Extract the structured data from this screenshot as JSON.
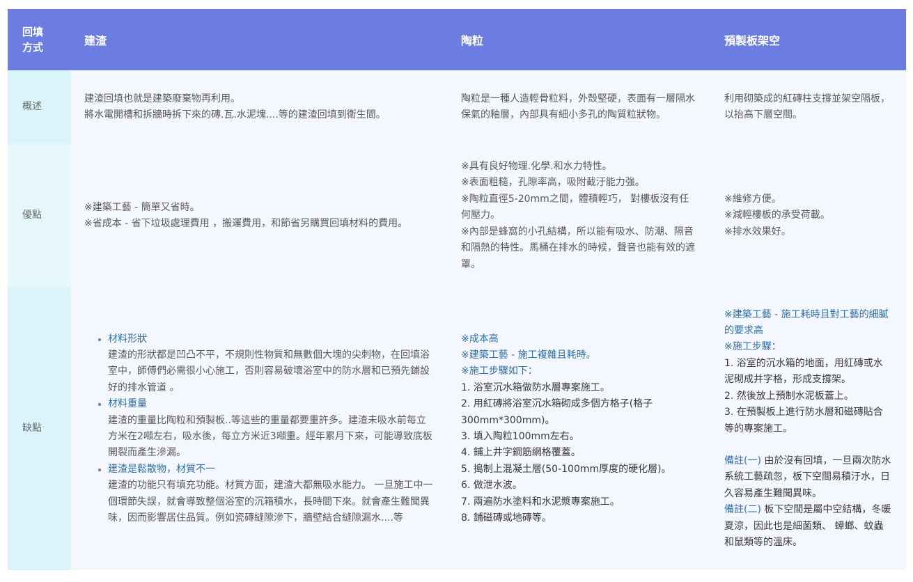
{
  "header": {
    "corner": [
      "回填",
      "方式"
    ],
    "col1": "建渣",
    "col2": "陶粒",
    "col3": "預製板架空"
  },
  "rows": {
    "overview": {
      "label": "概述",
      "col1": [
        "建渣回填也就是建築廢棄物再利用。",
        "將水電開槽和拆牆時拆下來的磚.瓦.水泥塊....等的建渣回填到衛生間。"
      ],
      "col2": [
        "陶粒是一種人造輕骨粒料，外殼堅硬，表面有一層隔水保氣的釉層，內部具有細小多孔的陶質粒狀物。"
      ],
      "col3": [
        "利用砌築成的紅磚柱支撐並架空隔板，以抬高下層空間。"
      ]
    },
    "advantages": {
      "label": "優點",
      "col1": [
        "※建築工藝 - 簡單又省時。",
        "※省成本 - 省下垃圾處理費用 ，搬運費用，和節省另購買回填材料的費用。"
      ],
      "col2": [
        "※具有良好物理.化學.和水力特性。",
        "※表面粗糙，孔隙率高，吸附截汙能力強。",
        "※陶粒直徑5-20mm之間，體積輕巧， 對樓板沒有任何壓力。",
        "※內部是蜂窩的小孔結構，所以能有吸水、防潮、隔音和隔熱的特性。馬桶在排水的時候，聲音也能有效的遮罩。"
      ],
      "col3": [
        "※維修方便。",
        "※減輕樓板的承受荷載。",
        "※排水效果好。"
      ]
    },
    "disadvantages": {
      "label": "缺點",
      "col1": [
        {
          "title": "材料形狀",
          "body": "建渣的形狀都是凹凸不平，不規則性物質和無數個大塊的尖刺物，在回填浴室中，師傅們必需很小心施工，否則容易破壞浴室中的防水層和已預先鋪設好的排水管道 。"
        },
        {
          "title": "材料重量",
          "body": "建渣的重量比陶粒和預製板..等這些的重量都要重許多。建渣未吸水前每立方米在2噸左右，吸水後，每立方米近3噸重。經年累月下來，可能導致底板開裂而產生滲漏。"
        },
        {
          "title": "建渣是鬆散物，材質不一",
          "body": "建渣的功能只有填充功能。材質方面，建渣大都無吸水能力。 一旦施工中一個環節失誤，就會導致整個浴室的沉箱積水，長時間下來。就會產生難聞異味，因而影響居住品質。例如瓷磚縫隙滲下，牆壁結合縫隙漏水....等"
        }
      ],
      "col2": {
        "heads": [
          "※成本高",
          "※建築工藝 - 施工複雜且耗時。",
          "※施工步驟如下："
        ],
        "steps": [
          "1. 浴室沉水箱做防水層專案施工。",
          "2. 用紅磚將浴室沉水箱砌成多個方格子(格子300mm*300mm)。",
          "3. 填入陶粒100mm左右。",
          "4. 鋪上井字鋼筋網格覆蓋。",
          "5. 搗制上混凝土層(50-100mm厚度的硬化層)。",
          "6. 做泄水波。",
          "7. 兩遍防水塗料和水泥漿專案施工。",
          "8. 鋪磁磚或地磚等。"
        ]
      },
      "col3": {
        "heads": [
          "※建築工藝 - 施工耗時且對工藝的細膩的要求高",
          "※施工步驟："
        ],
        "steps": [
          "1. 浴室的沉水箱的地面，用紅磚或水泥砌成井字格，形成支撐架。",
          "2. 然後放上預制水泥板蓋上。",
          "3. 在預製板上進行防水層和磁磚貼合等的專案施工。"
        ],
        "notes": [
          {
            "tag": "備註(一)",
            "text": " 由於沒有回填，一旦兩次防水系統工藝疏忽，板下空間易積汙水，日久容易產生難聞異味。"
          },
          {
            "tag": "備註(二)",
            "text": " 板下空間是屬中空結構，冬暖夏涼，因此也是細菌類、 蟑螂、蚊蟲和鼠類等的溫床。"
          }
        ]
      }
    }
  }
}
